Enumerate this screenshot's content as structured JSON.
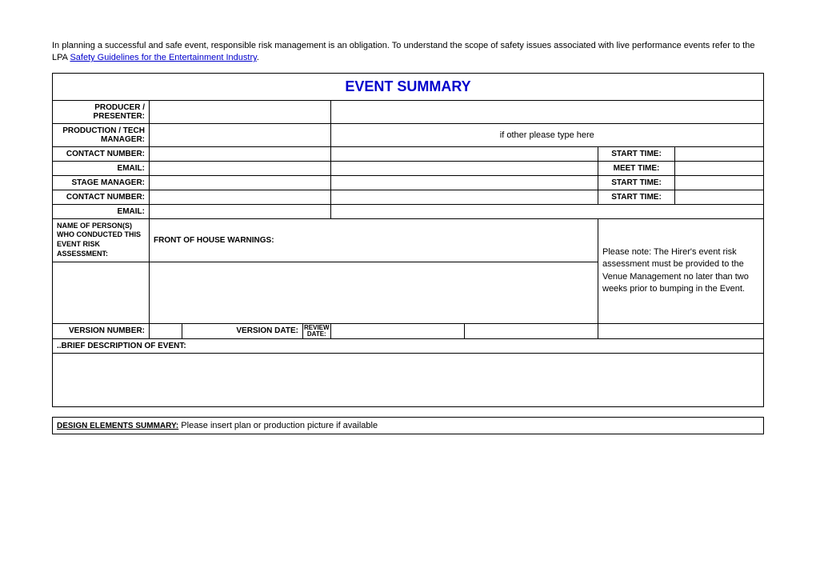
{
  "intro": {
    "text_before": "In planning a successful and safe event, responsible risk management is an obligation. To understand the scope of safety issues associated with live performance events refer to the LPA ",
    "link_text": "Safety Guidelines for the Entertainment Industry",
    "text_after": "."
  },
  "title": "EVENT SUMMARY",
  "labels": {
    "producer": "PRODUCER / PRESENTER:",
    "production_tech": "PRODUCTION / TECH MANAGER:",
    "contact_number": "CONTACT NUMBER:",
    "email": "EMAIL:",
    "stage_manager": "STAGE MANAGER:",
    "start_time": "START TIME:",
    "meet_time": "MEET TIME:",
    "name_persons": "NAME  OF PERSON(S) WHO CONDUCTED THIS EVENT RISK ASSESSMENT:",
    "foh_warnings": "FRONT OF HOUSE WARNINGS:",
    "version_number": "VERSION NUMBER:",
    "version_date": "VERSION DATE:",
    "review_date": "REVIEW DATE:",
    "brief_desc": "..BRIEF DESCRIPTION OF EVENT:",
    "other_placeholder": "if other please type here"
  },
  "note": "Please note: The Hirer's event risk assessment must be provided to the Venue Management no later than two weeks prior to bumping in the Event.",
  "design_elements": {
    "label": "DESIGN ELEMENTS SUMMARY:",
    "text": " Please insert plan or production picture if available"
  }
}
